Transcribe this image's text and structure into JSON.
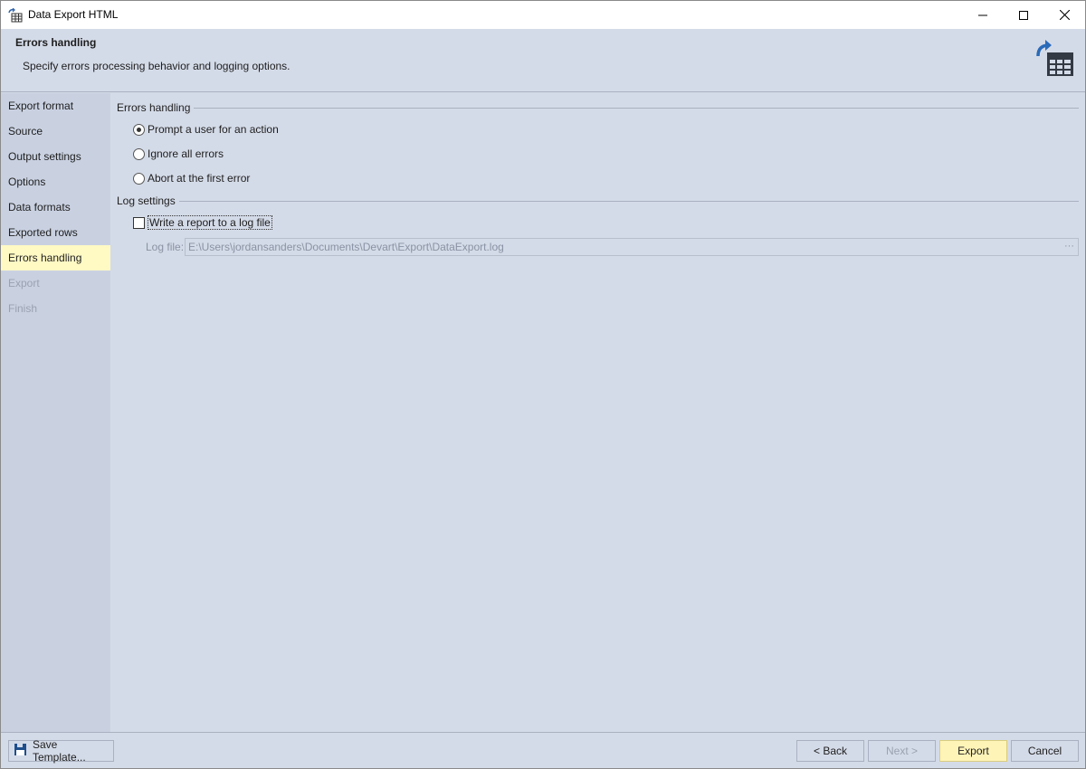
{
  "window": {
    "title": "Data Export HTML"
  },
  "header": {
    "title": "Errors handling",
    "subtitle": "Specify errors processing behavior and logging options."
  },
  "sidebar": {
    "items": [
      {
        "label": "Export format",
        "state": "normal"
      },
      {
        "label": "Source",
        "state": "normal"
      },
      {
        "label": "Output settings",
        "state": "normal"
      },
      {
        "label": "Options",
        "state": "normal"
      },
      {
        "label": "Data formats",
        "state": "normal"
      },
      {
        "label": "Exported rows",
        "state": "normal"
      },
      {
        "label": "Errors handling",
        "state": "active"
      },
      {
        "label": "Export",
        "state": "disabled"
      },
      {
        "label": "Finish",
        "state": "disabled"
      }
    ]
  },
  "errors_group": {
    "label": "Errors handling",
    "options": [
      {
        "label": "Prompt a user for an action",
        "selected": true
      },
      {
        "label": "Ignore all errors",
        "selected": false
      },
      {
        "label": "Abort at the first error",
        "selected": false
      }
    ]
  },
  "log_group": {
    "label": "Log settings",
    "write_report_label": "Write a report to a log file",
    "write_report_checked": false,
    "log_file_label": "Log file:",
    "log_file_value": "E:\\Users\\jordansanders\\Documents\\Devart\\Export\\DataExport.log",
    "browse_label": "···"
  },
  "footer": {
    "save_template_label": "Save Template...",
    "back_label": "< Back",
    "next_label": "Next >",
    "export_label": "Export",
    "cancel_label": "Cancel"
  },
  "colors": {
    "background": "#d4dbe8",
    "sidebar": "#c9d1e1",
    "active_item": "#fff9c4",
    "export_button": "#fff4b8"
  },
  "icons": {
    "app": "table-grid-icon",
    "header": "export-table-icon",
    "save": "floppy-disk-icon"
  }
}
